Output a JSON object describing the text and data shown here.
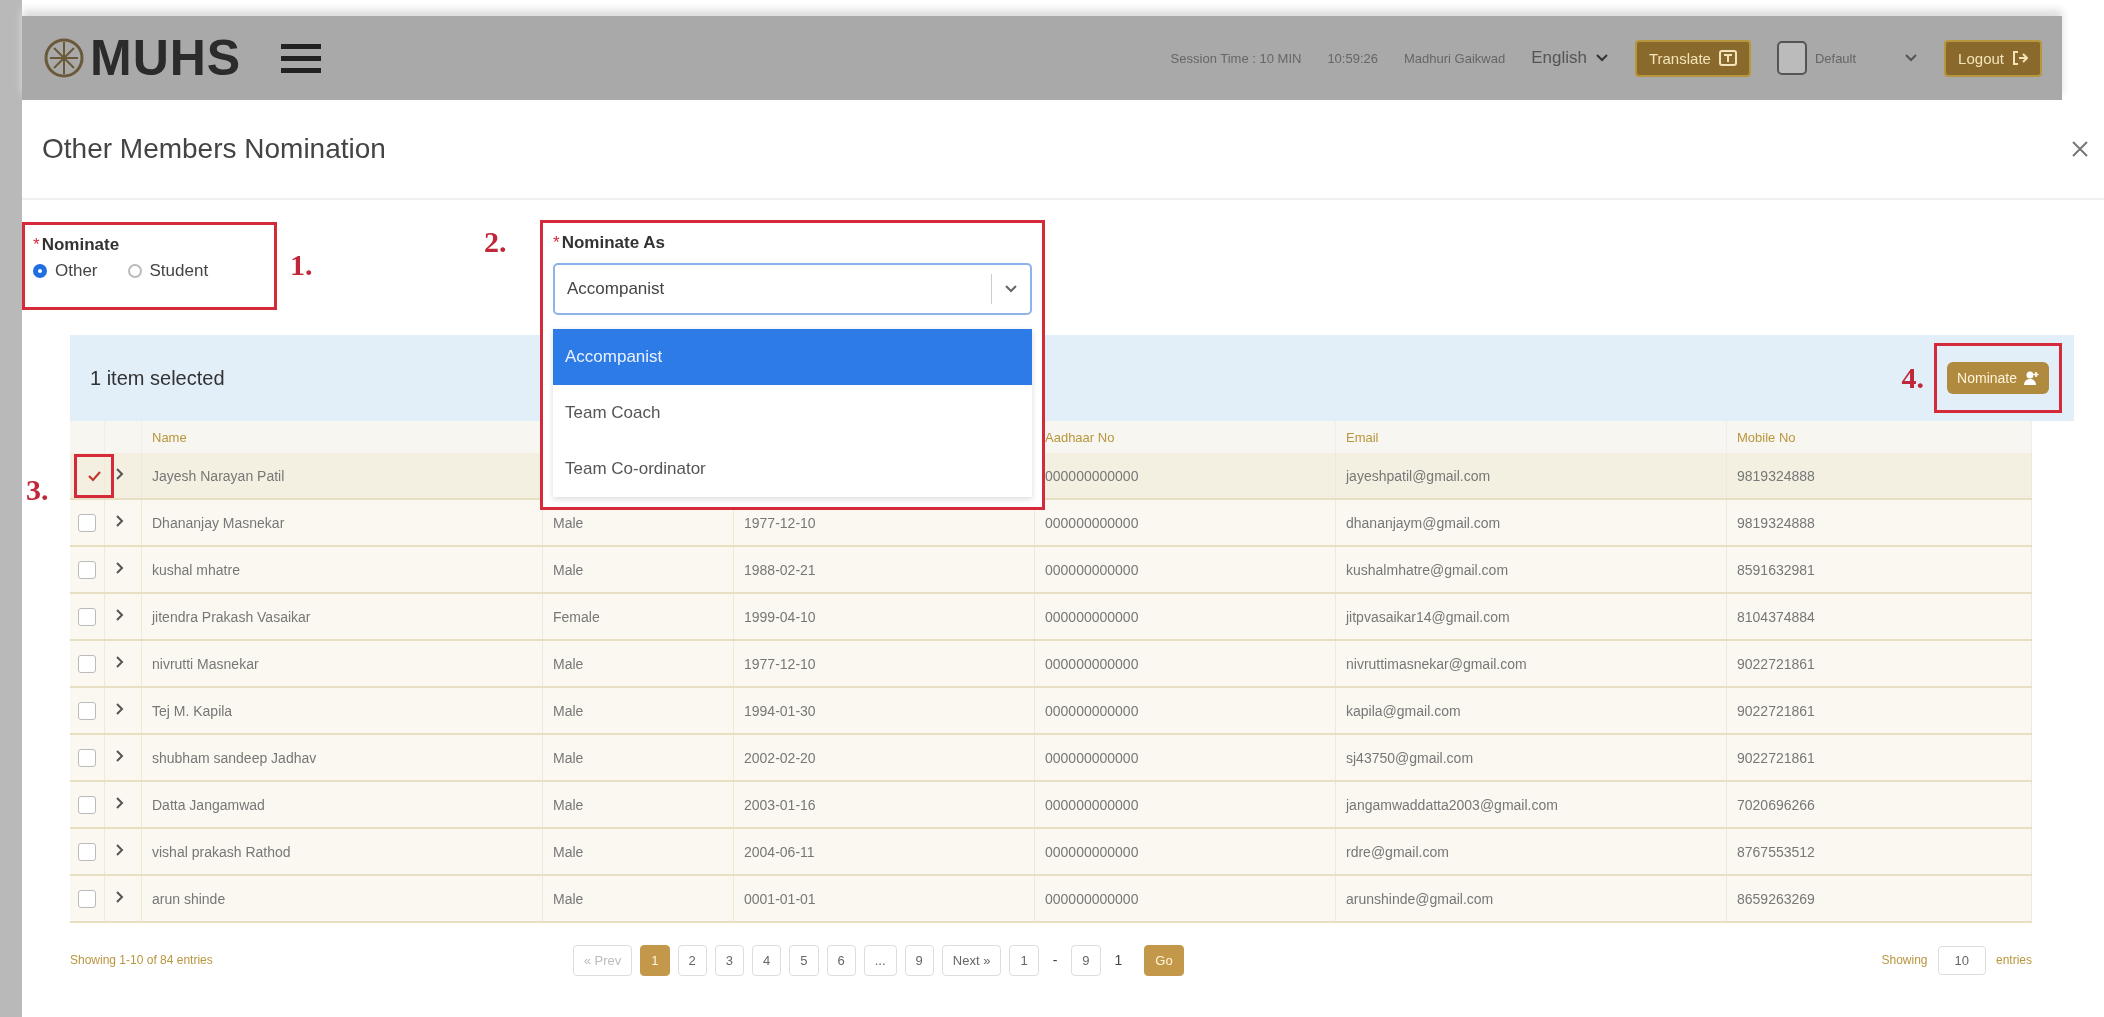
{
  "header": {
    "logo": "MUHS",
    "session_label": "Session Time : 10 MIN",
    "session_time": "10:59:26",
    "user": "Madhuri Gaikwad",
    "language": "English",
    "translate_button": "Translate",
    "default_check": {
      "label": "Default",
      "checked": false
    },
    "logout_button": "Logout"
  },
  "dialog": {
    "title": "Other Members Nomination"
  },
  "nominate": {
    "required_mark": "*",
    "label": "Nominate",
    "options": [
      {
        "label": "Other",
        "selected": true
      },
      {
        "label": "Student",
        "selected": false
      }
    ]
  },
  "nominate_as": {
    "required_mark": "*",
    "label": "Nominate As",
    "value": "Accompanist",
    "menu": [
      {
        "label": "Accompanist",
        "selected": true
      },
      {
        "label": "Team Coach",
        "selected": false
      },
      {
        "label": "Team Co-ordinator",
        "selected": false
      }
    ]
  },
  "selection_bar": {
    "text": "1 item selected",
    "nominate_button": "Nominate"
  },
  "table": {
    "columns": [
      "Name",
      null,
      null,
      "Aadhaar No",
      "Email",
      "Mobile No"
    ],
    "rows": [
      {
        "checked": true,
        "cells": [
          "Jayesh Narayan Patil",
          null,
          null,
          "000000000000",
          "jayeshpatil@gmail.com",
          "9819324888"
        ]
      },
      {
        "checked": false,
        "cells": [
          "Dhananjay Masnekar",
          "Male",
          "1977-12-10",
          "000000000000",
          "dhananjaym@gmail.com",
          "9819324888"
        ]
      },
      {
        "checked": false,
        "cells": [
          "kushal mhatre",
          "Male",
          "1988-02-21",
          "000000000000",
          "kushalmhatre@gmail.com",
          "8591632981"
        ]
      },
      {
        "checked": false,
        "cells": [
          "jitendra Prakash Vasaikar",
          "Female",
          "1999-04-10",
          "000000000000",
          "jitpvasaikar14@gmail.com",
          "8104374884"
        ]
      },
      {
        "checked": false,
        "cells": [
          "nivrutti Masnekar",
          "Male",
          "1977-12-10",
          "000000000000",
          "nivruttimasnekar@gmail.com",
          "9022721861"
        ]
      },
      {
        "checked": false,
        "cells": [
          "Tej M. Kapila",
          "Male",
          "1994-01-30",
          "000000000000",
          "kapila@gmail.com",
          "9022721861"
        ]
      },
      {
        "checked": false,
        "cells": [
          "shubham sandeep Jadhav",
          "Male",
          "2002-02-20",
          "000000000000",
          "sj43750@gmail.com",
          "9022721861"
        ]
      },
      {
        "checked": false,
        "cells": [
          "Datta Jangamwad",
          "Male",
          "2003-01-16",
          "000000000000",
          "jangamwaddatta2003@gmail.com",
          "7020696266"
        ]
      },
      {
        "checked": false,
        "cells": [
          "vishal prakash Rathod",
          "Male",
          "2004-06-11",
          "000000000000",
          "rdre@gmail.com",
          "8767553512"
        ]
      },
      {
        "checked": false,
        "cells": [
          "arun shinde",
          "Male",
          "0001-01-01",
          "000000000000",
          "arunshinde@gmail.com",
          "8659263269"
        ]
      }
    ]
  },
  "footer": {
    "info": "Showing 1-10 of 84 entries",
    "prev": "« Prev",
    "pages": [
      {
        "label": "1",
        "selected": true
      },
      {
        "label": "2",
        "selected": false
      },
      {
        "label": "3",
        "selected": false
      },
      {
        "label": "4",
        "selected": false
      },
      {
        "label": "5",
        "selected": false
      },
      {
        "label": "6",
        "selected": false
      },
      {
        "label": "...",
        "selected": false
      },
      {
        "label": "9",
        "selected": false
      }
    ],
    "next": "Next »",
    "goto_from": "1",
    "goto_sep": "-",
    "goto_to": "9",
    "goto_value": "1",
    "go_button": "Go",
    "show_label": "Showing",
    "page_size": "10",
    "entries_label": "entries"
  },
  "callouts": [
    {
      "label": "1."
    },
    {
      "label": "2."
    },
    {
      "label": "3."
    },
    {
      "label": "4."
    }
  ]
}
